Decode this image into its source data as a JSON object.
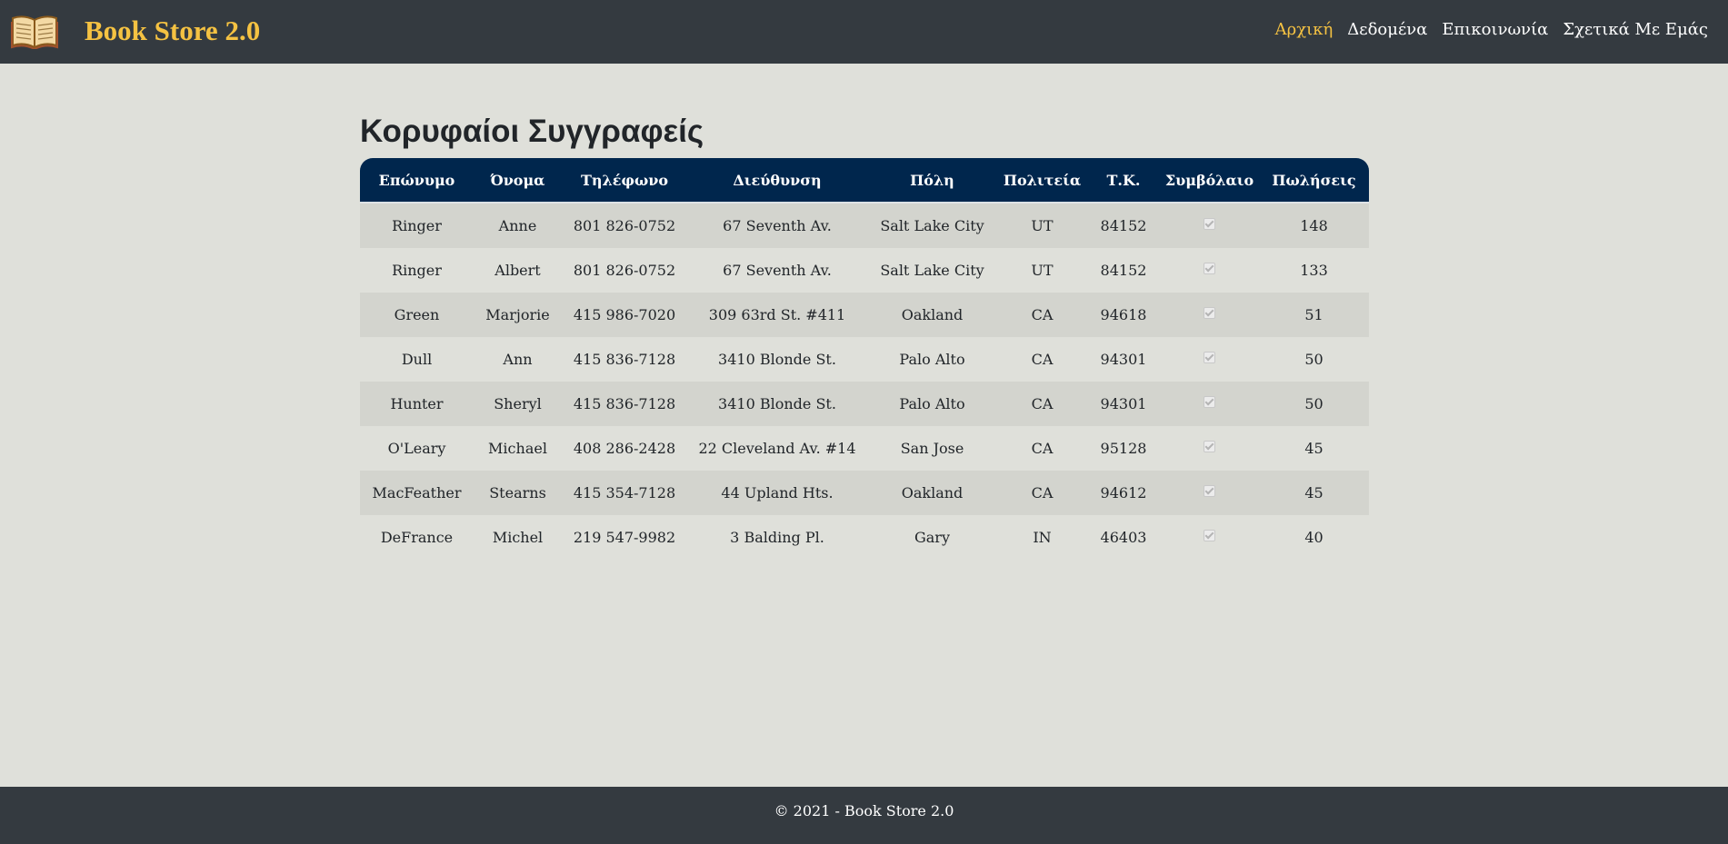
{
  "navbar": {
    "brand_title": "Book Store 2.0",
    "brand_icon": "open-book-icon",
    "links": [
      {
        "label": "Αρχική",
        "active": true
      },
      {
        "label": "Δεδομένα",
        "active": false
      },
      {
        "label": "Επικοινωνία",
        "active": false
      },
      {
        "label": "Σχετικά Με Εμάς",
        "active": false
      }
    ]
  },
  "main": {
    "title": "Κορυφαίοι Συγγραφείς",
    "table": {
      "columns": [
        "Επώνυμο",
        "Όνομα",
        "Τηλέφωνο",
        "Διεύθυνση",
        "Πόλη",
        "Πολιτεία",
        "Τ.Κ.",
        "Συμβόλαιο",
        "Πωλήσεις"
      ],
      "rows": [
        [
          "Ringer",
          "Anne",
          "801 826-0752",
          "67 Seventh Av.",
          "Salt Lake City",
          "UT",
          "84152",
          true,
          "148"
        ],
        [
          "Ringer",
          "Albert",
          "801 826-0752",
          "67 Seventh Av.",
          "Salt Lake City",
          "UT",
          "84152",
          true,
          "133"
        ],
        [
          "Green",
          "Marjorie",
          "415 986-7020",
          "309 63rd St. #411",
          "Oakland",
          "CA",
          "94618",
          true,
          "51"
        ],
        [
          "Dull",
          "Ann",
          "415 836-7128",
          "3410 Blonde St.",
          "Palo Alto",
          "CA",
          "94301",
          true,
          "50"
        ],
        [
          "Hunter",
          "Sheryl",
          "415 836-7128",
          "3410 Blonde St.",
          "Palo Alto",
          "CA",
          "94301",
          true,
          "50"
        ],
        [
          "O'Leary",
          "Michael",
          "408 286-2428",
          "22 Cleveland Av. #14",
          "San Jose",
          "CA",
          "95128",
          true,
          "45"
        ],
        [
          "MacFeather",
          "Stearns",
          "415 354-7128",
          "44 Upland Hts.",
          "Oakland",
          "CA",
          "94612",
          true,
          "45"
        ],
        [
          "DeFrance",
          "Michel",
          "219 547-9982",
          "3 Balding Pl.",
          "Gary",
          "IN",
          "46403",
          true,
          "40"
        ]
      ]
    }
  },
  "footer": {
    "text": "© 2021 - Book Store 2.0"
  },
  "colors": {
    "navbar_bg": "#343a40",
    "brand_accent": "#f5c242",
    "table_header_bg": "#00264d",
    "page_bg": "#dfe0da",
    "row_stripe": "#d3d4ce"
  }
}
